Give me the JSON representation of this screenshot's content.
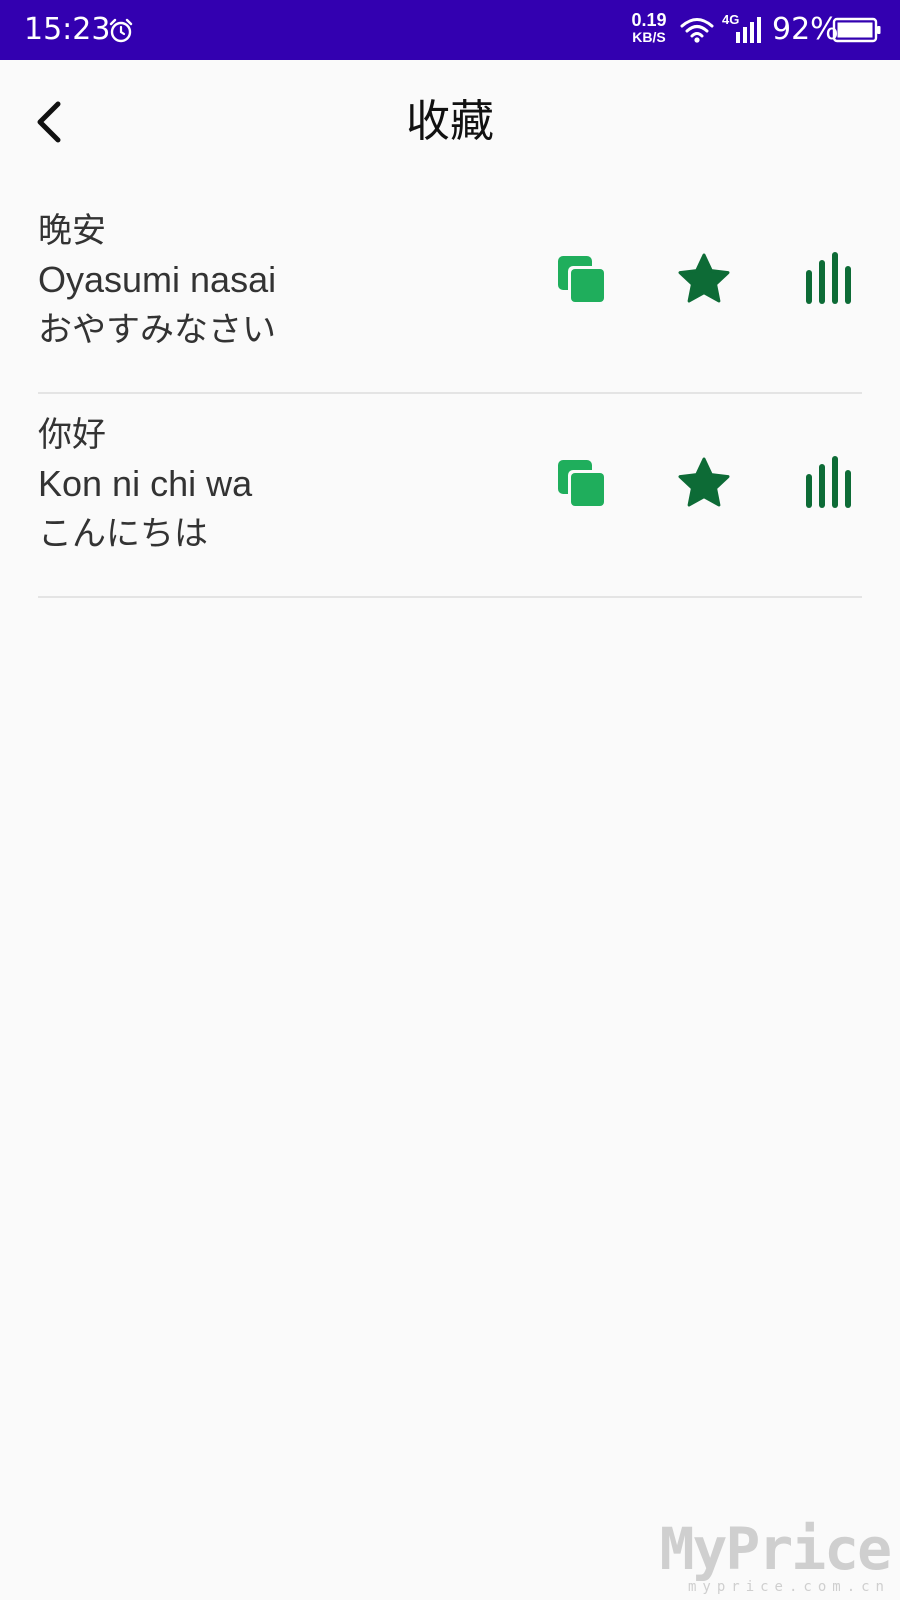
{
  "status_bar": {
    "time": "15:23",
    "net_speed_value": "0.19",
    "net_speed_unit": "KB/S",
    "network_type": "4G",
    "battery_percent": "92%",
    "icons": [
      "alarm-icon",
      "wifi-icon",
      "signal-icon",
      "battery-icon"
    ],
    "background_color": "#3300b0"
  },
  "header": {
    "back_icon": "chevron-left-icon",
    "title": "收藏"
  },
  "favorites": [
    {
      "chinese": "晚安",
      "romaji": "Oyasumi nasai",
      "kana": "おやすみなさい",
      "actions": [
        "copy-icon",
        "star-icon",
        "audio-icon"
      ]
    },
    {
      "chinese": "你好",
      "romaji": "Kon ni chi wa",
      "kana": "こんにちは",
      "actions": [
        "copy-icon",
        "star-icon",
        "audio-icon"
      ]
    }
  ],
  "colors": {
    "copy_icon": "#1fae5c",
    "star_icon": "#0d6b36",
    "audio_icon": "#0d6b36",
    "divider": "#e4e4e4",
    "text": "#333333"
  },
  "watermark": {
    "brand": "MyPrice",
    "domain": "myprice.com.cn"
  }
}
